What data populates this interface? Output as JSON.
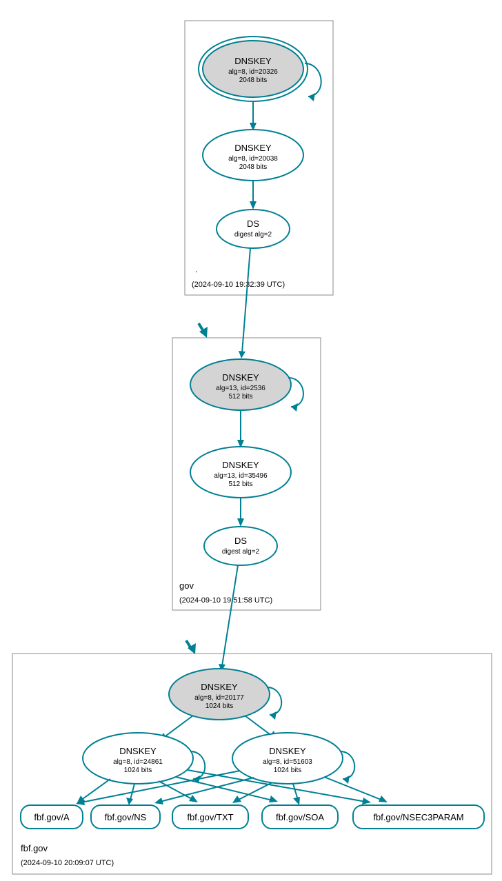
{
  "zones": {
    "root": {
      "label": ".",
      "timestamp": "(2024-09-10 19:32:39 UTC)"
    },
    "gov": {
      "label": "gov",
      "timestamp": "(2024-09-10 19:51:58 UTC)"
    },
    "fbf": {
      "label": "fbf.gov",
      "timestamp": "(2024-09-10 20:09:07 UTC)"
    }
  },
  "nodes": {
    "root_key1": {
      "title": "DNSKEY",
      "sub1": "alg=8, id=20326",
      "sub2": "2048 bits"
    },
    "root_key2": {
      "title": "DNSKEY",
      "sub1": "alg=8, id=20038",
      "sub2": "2048 bits"
    },
    "root_ds": {
      "title": "DS",
      "sub1": "digest alg=2"
    },
    "gov_key1": {
      "title": "DNSKEY",
      "sub1": "alg=13, id=2536",
      "sub2": "512 bits"
    },
    "gov_key2": {
      "title": "DNSKEY",
      "sub1": "alg=13, id=35496",
      "sub2": "512 bits"
    },
    "gov_ds": {
      "title": "DS",
      "sub1": "digest alg=2"
    },
    "fbf_key1": {
      "title": "DNSKEY",
      "sub1": "alg=8, id=20177",
      "sub2": "1024 bits"
    },
    "fbf_key2": {
      "title": "DNSKEY",
      "sub1": "alg=8, id=24861",
      "sub2": "1024 bits"
    },
    "fbf_key3": {
      "title": "DNSKEY",
      "sub1": "alg=8, id=51603",
      "sub2": "1024 bits"
    }
  },
  "records": {
    "a": "fbf.gov/A",
    "ns": "fbf.gov/NS",
    "txt": "fbf.gov/TXT",
    "soa": "fbf.gov/SOA",
    "nsec": "fbf.gov/NSEC3PARAM"
  }
}
